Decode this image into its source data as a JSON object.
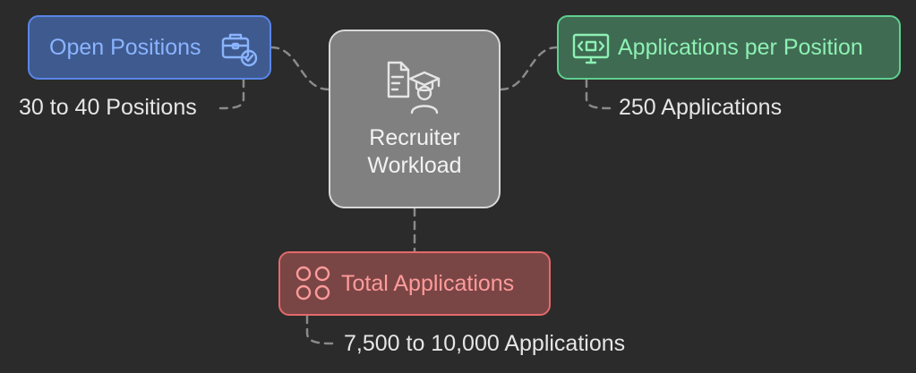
{
  "center": {
    "label_line1": "Recruiter",
    "label_line2": "Workload",
    "icon": "recruiter-icon"
  },
  "nodes": {
    "open_positions": {
      "label": "Open Positions",
      "note": "30 to 40 Positions",
      "icon": "briefcase-check-icon",
      "color": "#5a86e8"
    },
    "applications_per_position": {
      "label": "Applications per Position",
      "note": "250 Applications",
      "icon": "monitor-code-icon",
      "color": "#5fd08f"
    },
    "total_applications": {
      "label": "Total Applications",
      "note": "7,500 to 10,000 Applications",
      "icon": "four-circles-icon",
      "color": "#e46a6a"
    }
  },
  "colors": {
    "background": "#2b2b2b",
    "connector": "#8a8a8a",
    "center_fill": "#808080"
  }
}
